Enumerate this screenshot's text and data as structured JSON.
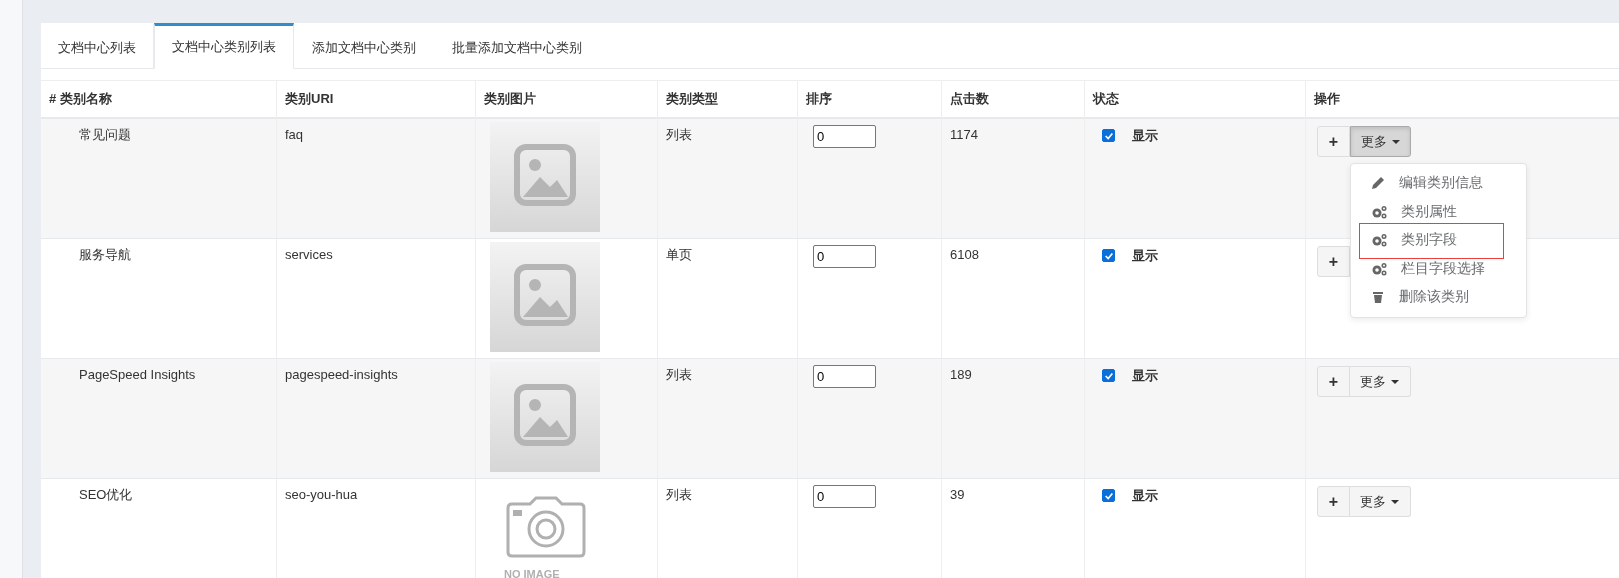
{
  "tabs": [
    {
      "label": "文档中心列表",
      "selected": false
    },
    {
      "label": "文档中心类别列表",
      "selected": true
    },
    {
      "label": "添加文档中心类别",
      "selected": false
    },
    {
      "label": "批量添加文档中心类别",
      "selected": false
    }
  ],
  "table": {
    "columns": [
      "# 类别名称",
      "类别URI",
      "类别图片",
      "类别类型",
      "排序",
      "点击数",
      "状态",
      "操作"
    ],
    "rows": [
      {
        "name": "常见问题",
        "uri": "faq",
        "image": {
          "kind": "placeholder"
        },
        "type": "列表",
        "order": "0",
        "clicks": "1174",
        "shown": true,
        "status_label": "显示",
        "add": "+",
        "more": "更多",
        "menu": [
          {
            "kind": "pencil",
            "label": "编辑类别信息",
            "highlighted": false
          },
          {
            "kind": "gears",
            "label": "类别属性",
            "highlighted": false
          },
          {
            "kind": "gears",
            "label": "类别字段",
            "highlighted": true
          },
          {
            "kind": "gears",
            "label": "栏目字段选择",
            "highlighted": false
          },
          {
            "kind": "trash",
            "label": "删除该类别",
            "highlighted": false
          }
        ]
      },
      {
        "name": "服务导航",
        "uri": "services",
        "image": {
          "kind": "placeholder"
        },
        "type": "单页",
        "order": "0",
        "clicks": "6108",
        "shown": true,
        "status_label": "显示",
        "add": "+"
      },
      {
        "name": "PageSpeed Insights",
        "uri": "pagespeed-insights",
        "image": {
          "kind": "placeholder"
        },
        "type": "列表",
        "order": "0",
        "clicks": "189",
        "shown": true,
        "status_label": "显示",
        "add": "+",
        "more": "更多"
      },
      {
        "name": "SEO优化",
        "uri": "seo-you-hua",
        "image": {
          "kind": "no_image",
          "caption": "NO IMAGE"
        },
        "type": "列表",
        "order": "0",
        "clicks": "39",
        "shown": true,
        "status_label": "显示",
        "add": "+",
        "more": "更多"
      }
    ]
  }
}
